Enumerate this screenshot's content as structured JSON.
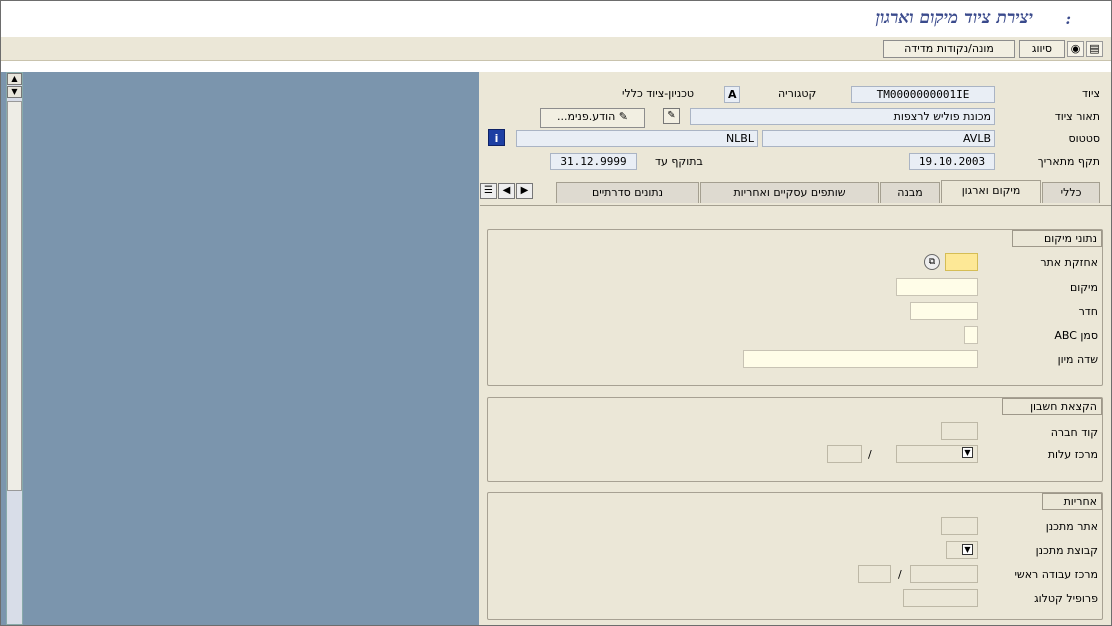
{
  "window": {
    "title": "יצירת ציוד מיקום וארגון",
    "title_suffix": ":"
  },
  "toolbar": {
    "btn1": "מונה/נקודות מדידה",
    "btn2": "סיווג",
    "icon_find": "binoculars-icon",
    "icon_doc": "document-icon"
  },
  "header": {
    "equipment_label": "ציוד",
    "equipment_value": "TM0000000001IE",
    "category_label": "קטגוריה",
    "category_value": "A",
    "category_desc": "טכניון-ציוד כללי",
    "description_label": "תאור ציוד",
    "description_value": "מכונת פוליש לרצפות",
    "internal_note_button": "הודע.פנימ...",
    "status_label": "סטטוס",
    "status_value": "AVLB",
    "status_user": "NLBL",
    "valid_from_label": "תקף מתאריך",
    "valid_from_value": "19.10.2003",
    "valid_to_label": "בתוקף עד",
    "valid_to_value": "31.12.9999"
  },
  "tabs": [
    {
      "label": "כללי"
    },
    {
      "label": "מיקום וארגון"
    },
    {
      "label": "מבנה"
    },
    {
      "label": "שותפים עסקיים ואחריות"
    },
    {
      "label": "נתונים סדרתיים"
    }
  ],
  "location_section": {
    "title": "נתוני מיקום",
    "maintenance_plant_label": "אחזקת אתר",
    "location_label": "מיקום",
    "room_label": "חדר",
    "abc_label": "סמן ABC",
    "sort_field_label": "שדה מיון"
  },
  "account_section": {
    "title": "הקצאת חשבון",
    "company_code_label": "קוד חברה",
    "cost_center_label": "מרכז עלות",
    "separator": "/"
  },
  "responsibility_section": {
    "title": "אחריות",
    "planning_plant_label": "אתר מתכנן",
    "planner_group_label": "קבוצת מתכנן",
    "main_work_center_label": "מרכז עבודה ראשי",
    "separator": "/",
    "catalog_profile_label": "פרופיל קטלוג"
  }
}
